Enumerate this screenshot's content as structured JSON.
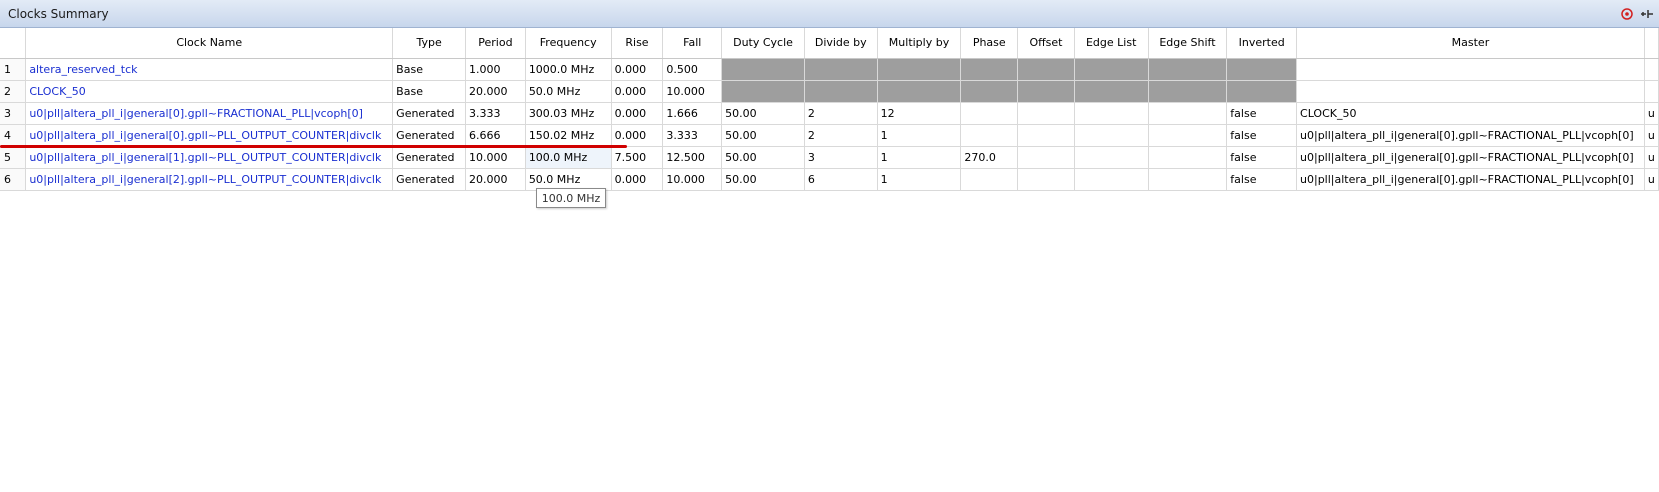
{
  "window": {
    "title": "Clocks Summary",
    "icons": [
      "close-circle-icon",
      "pin-icon"
    ]
  },
  "columns": [
    "",
    "Clock Name",
    "Type",
    "Period",
    "Frequency",
    "Rise",
    "Fall",
    "Duty Cycle",
    "Divide by",
    "Multiply by",
    "Phase",
    "Offset",
    "Edge List",
    "Edge Shift",
    "Inverted",
    "Master",
    ""
  ],
  "rows": [
    {
      "num": "1",
      "name": "altera_reserved_tck",
      "type": "Base",
      "period": "1.000",
      "frequency": "1000.0 MHz",
      "rise": "0.000",
      "fall": "0.500",
      "duty": "",
      "divide": "",
      "multiply": "",
      "phase": "",
      "offset": "",
      "edge_list": "",
      "edge_shift": "",
      "inverted": "",
      "master": "",
      "extra": ""
    },
    {
      "num": "2",
      "name": "CLOCK_50",
      "type": "Base",
      "period": "20.000",
      "frequency": "50.0 MHz",
      "rise": "0.000",
      "fall": "10.000",
      "duty": "",
      "divide": "",
      "multiply": "",
      "phase": "",
      "offset": "",
      "edge_list": "",
      "edge_shift": "",
      "inverted": "",
      "master": "",
      "extra": ""
    },
    {
      "num": "3",
      "name": "u0|pll|altera_pll_i|general[0].gpll~FRACTIONAL_PLL|vcoph[0]",
      "type": "Generated",
      "period": "3.333",
      "frequency": "300.03 MHz",
      "rise": "0.000",
      "fall": "1.666",
      "duty": "50.00",
      "divide": "2",
      "multiply": "12",
      "phase": "",
      "offset": "",
      "edge_list": "",
      "edge_shift": "",
      "inverted": "false",
      "master": "CLOCK_50",
      "extra": "u"
    },
    {
      "num": "4",
      "name": "u0|pll|altera_pll_i|general[0].gpll~PLL_OUTPUT_COUNTER|divclk",
      "type": "Generated",
      "period": "6.666",
      "frequency": "150.02 MHz",
      "rise": "0.000",
      "fall": "3.333",
      "duty": "50.00",
      "divide": "2",
      "multiply": "1",
      "phase": "",
      "offset": "",
      "edge_list": "",
      "edge_shift": "",
      "inverted": "false",
      "master": "u0|pll|altera_pll_i|general[0].gpll~FRACTIONAL_PLL|vcoph[0]",
      "extra": "u"
    },
    {
      "num": "5",
      "name": "u0|pll|altera_pll_i|general[1].gpll~PLL_OUTPUT_COUNTER|divclk",
      "type": "Generated",
      "period": "10.000",
      "frequency": "100.0 MHz",
      "rise": "7.500",
      "fall": "12.500",
      "duty": "50.00",
      "divide": "3",
      "multiply": "1",
      "phase": "270.0",
      "offset": "",
      "edge_list": "",
      "edge_shift": "",
      "inverted": "false",
      "master": "u0|pll|altera_pll_i|general[0].gpll~FRACTIONAL_PLL|vcoph[0]",
      "extra": "u"
    },
    {
      "num": "6",
      "name": "u0|pll|altera_pll_i|general[2].gpll~PLL_OUTPUT_COUNTER|divclk",
      "type": "Generated",
      "period": "20.000",
      "frequency": "50.0 MHz",
      "rise": "0.000",
      "fall": "10.000",
      "duty": "50.00",
      "divide": "6",
      "multiply": "1",
      "phase": "",
      "offset": "",
      "edge_list": "",
      "edge_shift": "",
      "inverted": "false",
      "master": "u0|pll|altera_pll_i|general[0].gpll~FRACTIONAL_PLL|vcoph[0]",
      "extra": "u"
    }
  ],
  "tooltip": {
    "text": "100.0 MHz"
  },
  "colors": {
    "link": "#1a2fd1",
    "disabled_cell": "#9e9e9e",
    "annotation": "#d00000"
  }
}
